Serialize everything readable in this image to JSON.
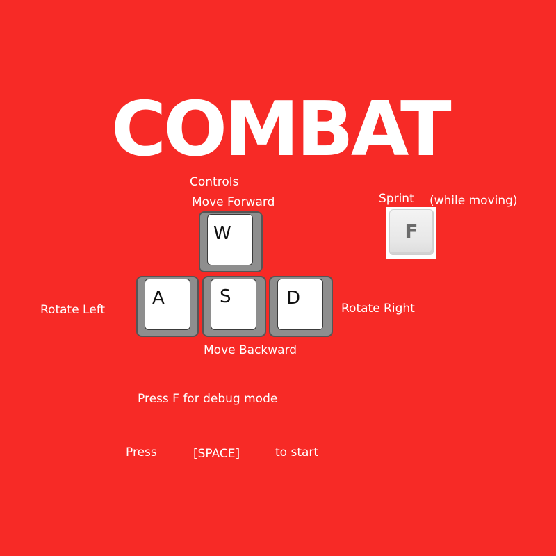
{
  "title": "COMBAT",
  "controls_heading": "Controls",
  "keys": {
    "w": {
      "letter": "W",
      "action": "Move Forward"
    },
    "a": {
      "letter": "A",
      "action": "Rotate Left"
    },
    "s": {
      "letter": "S",
      "action": "Move Backward"
    },
    "d": {
      "letter": "D",
      "action": "Rotate Right"
    },
    "f": {
      "letter": "F",
      "action": "Sprint",
      "note": "(while moving)"
    }
  },
  "debug_hint": "Press F for debug mode",
  "start_prompt": {
    "prefix": "Press",
    "key": "[SPACE]",
    "suffix": "to start"
  },
  "colors": {
    "background": "#f72a26",
    "text": "#ffffff",
    "key_border": "#8e8e8e",
    "key_face": "#ffffff"
  }
}
